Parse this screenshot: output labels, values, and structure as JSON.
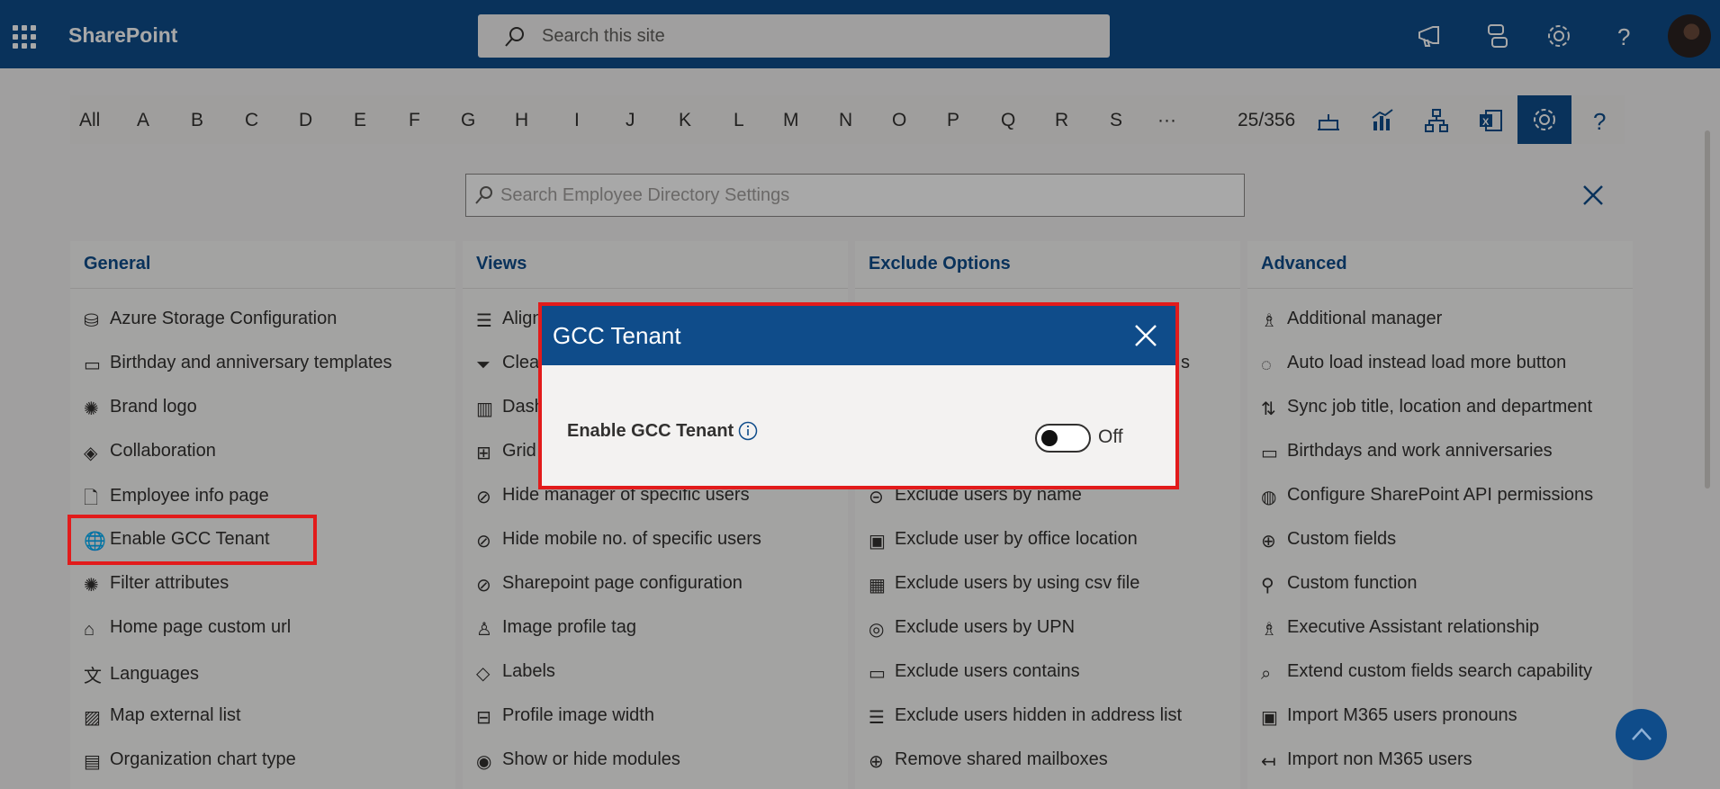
{
  "topbar": {
    "brand": "SharePoint",
    "search_placeholder": "Search this site",
    "icons": [
      "app-launcher-icon",
      "megaphone-icon",
      "feedback-icon",
      "gear-icon",
      "help-icon",
      "avatar"
    ]
  },
  "alphabet": {
    "letters": [
      "All",
      "A",
      "B",
      "C",
      "D",
      "E",
      "F",
      "G",
      "H",
      "I",
      "J",
      "K",
      "L",
      "M",
      "N",
      "O",
      "P",
      "Q",
      "R",
      "S",
      "···"
    ],
    "count": "25/356",
    "tools": [
      "birthday-cake-icon",
      "chart-icon",
      "org-chart-icon",
      "excel-icon",
      "settings-icon",
      "help-icon"
    ]
  },
  "settings_search": {
    "placeholder": "Search Employee Directory Settings"
  },
  "columns": {
    "general": {
      "title": "General",
      "items": [
        "Azure Storage Configuration",
        "Birthday and anniversary templates",
        "Brand logo",
        "Collaboration",
        "Employee info page",
        "Enable GCC Tenant",
        "Filter attributes",
        "Home page custom url",
        "Languages",
        "Map external list",
        "Organization chart type"
      ]
    },
    "views": {
      "title": "Views",
      "items": [
        "Align",
        "Clea",
        "Dash",
        "Grid",
        "Hide manager of specific users",
        "Hide mobile no. of specific users",
        "Sharepoint page configuration",
        "Image profile tag",
        "Labels",
        "Profile image width",
        "Show or hide modules"
      ]
    },
    "exclude": {
      "title": "Exclude Options",
      "items": [
        "s",
        "Exclude users by name",
        "Exclude user by office location",
        "Exclude users by using csv file",
        "Exclude users by UPN",
        "Exclude users contains",
        "Exclude users hidden in address list",
        "Remove shared mailboxes"
      ]
    },
    "advanced": {
      "title": "Advanced",
      "items": [
        "Additional manager",
        "Auto load instead load more button",
        "Sync job title, location and department",
        "Birthdays and work anniversaries",
        "Configure SharePoint API permissions",
        "Custom fields",
        "Custom function",
        "Executive Assistant relationship",
        "Extend custom fields search capability",
        "Import M365 users pronouns",
        "Import non M365 users"
      ]
    }
  },
  "dialog": {
    "title": "GCC Tenant",
    "setting_label": "Enable GCC Tenant",
    "toggle_state": "Off",
    "toggle_on": false
  },
  "colors": {
    "brand": "#0f4c8a",
    "highlight": "#e21b1b"
  }
}
